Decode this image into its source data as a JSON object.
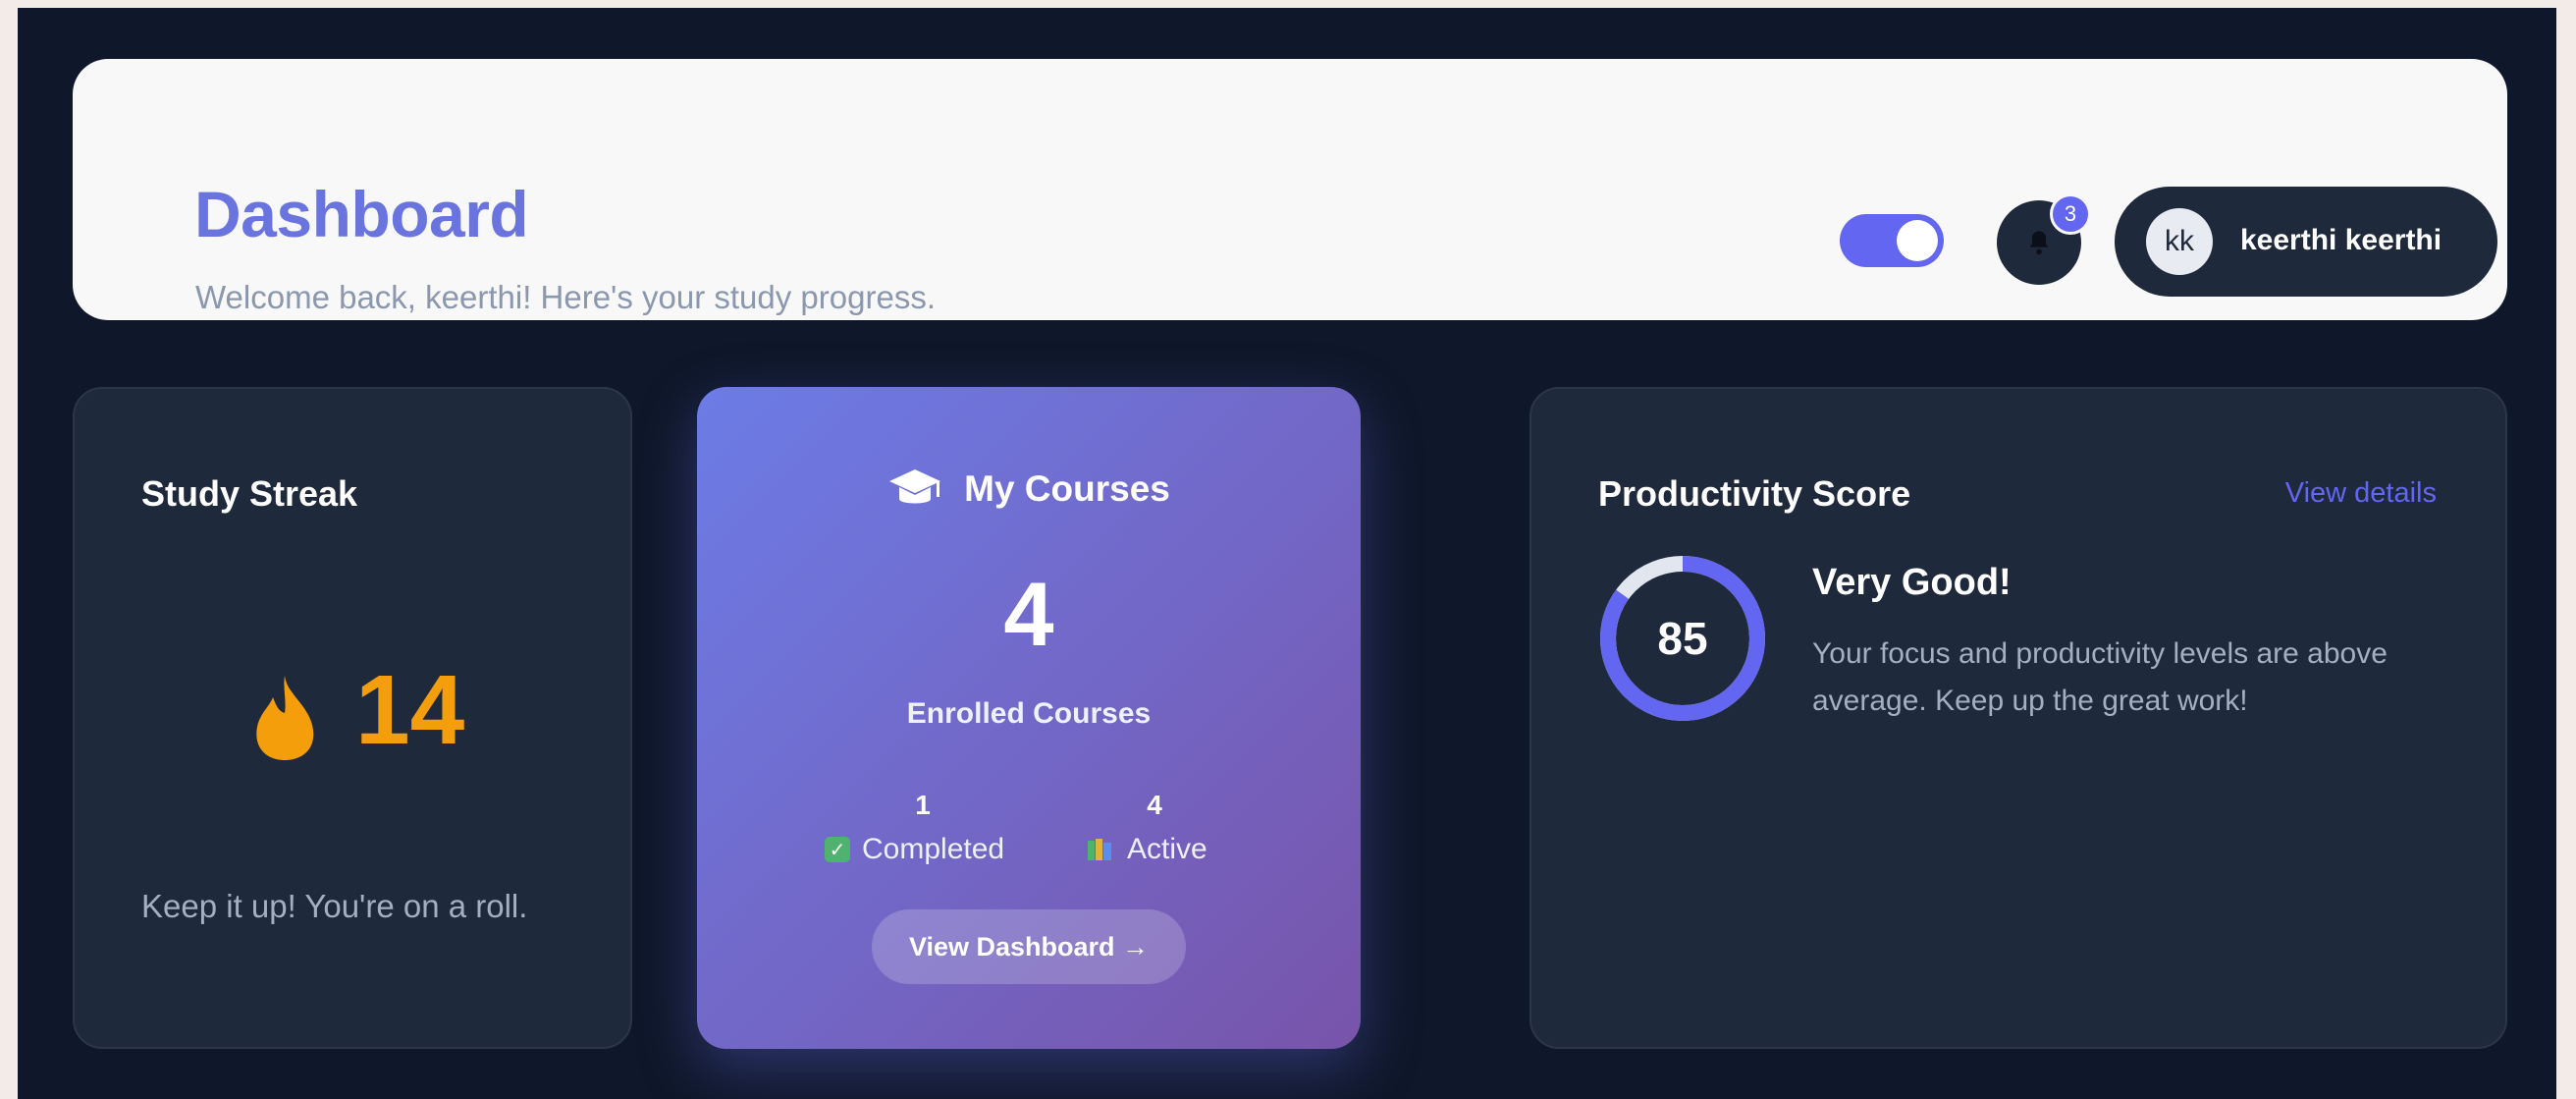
{
  "header": {
    "title": "Dashboard",
    "subtitle": "Welcome back, keerthi! Here's your study progress.",
    "theme_toggle_on": true,
    "notification_count": "3",
    "user_initials": "kk",
    "user_name": "keerthi keerthi"
  },
  "streak": {
    "title": "Study Streak",
    "icon": "flame-icon",
    "value": "14",
    "message": "Keep it up! You're on a roll."
  },
  "courses": {
    "icon": "graduation-cap-icon",
    "title": "My Courses",
    "count": "4",
    "label": "Enrolled Courses",
    "completed_count": "1",
    "completed_label": "Completed",
    "active_count": "4",
    "active_label": "Active",
    "button_label": "View Dashboard →"
  },
  "productivity": {
    "title": "Productivity Score",
    "link_label": "View details",
    "score": "85",
    "score_fraction": 0.85,
    "status": "Very Good!",
    "description": "Your focus and productivity levels are above average. Keep up the great work!"
  },
  "colors": {
    "background": "#0f172a",
    "card": "#1e293b",
    "accent": "#6366f1",
    "title": "#6a74df",
    "streak": "#f59e0b"
  }
}
